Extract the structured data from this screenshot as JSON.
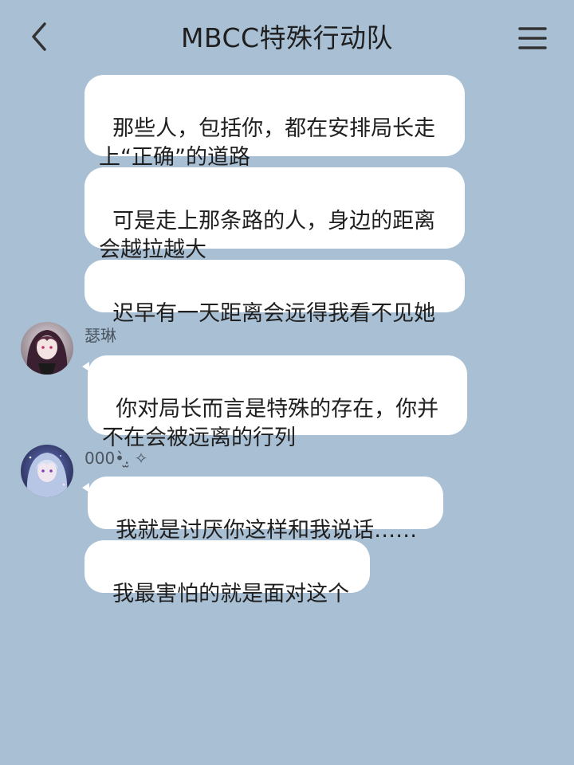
{
  "header": {
    "title": "MBCC特殊行动队",
    "back_icon": "chevron-left-icon",
    "menu_icon": "hamburger-menu-icon"
  },
  "messages": [
    {
      "text": "那些人，包括你，都在安排局长走上“正确”的道路"
    },
    {
      "text": "可是走上那条路的人，身边的距离会越拉越大"
    },
    {
      "text": "迟早有一天距离会远得我看不见她"
    },
    {
      "sender": "瑟琳",
      "text": "你对局长而言是特殊的存在，你并不在会被远离的行列"
    },
    {
      "sender": "000•̀.̫ ✧",
      "text": "我就是讨厌你这样和我说话……"
    },
    {
      "text": "我最害怕的就是面对这个"
    }
  ],
  "colors": {
    "background": "#a9bfd4",
    "bubble": "#ffffff",
    "text": "#1f1f1f"
  }
}
